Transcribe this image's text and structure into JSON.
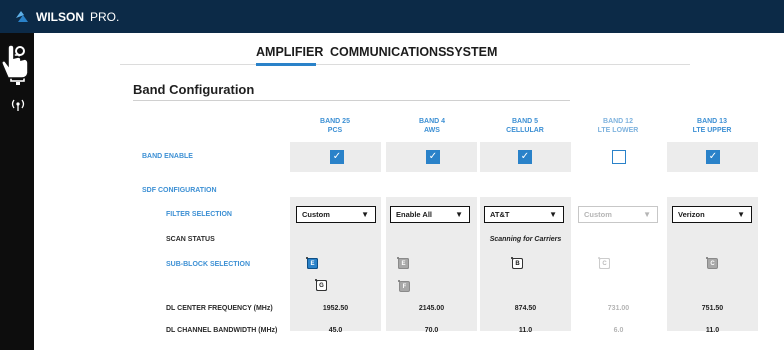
{
  "header": {
    "brand": "WILSON",
    "brand_suffix": "PRO."
  },
  "sidebar": {
    "icons": [
      "settings-icon",
      "network-icon",
      "antenna-icon"
    ]
  },
  "nav": {
    "tabs": [
      "AMPLIFIER",
      "COMMUNICATIONS",
      "SYSTEM"
    ],
    "active": "AMPLIFIER"
  },
  "section": {
    "title": "Band Configuration"
  },
  "columns": [
    {
      "line1": "BAND 25",
      "line2": "PCS",
      "enabled": true
    },
    {
      "line1": "BAND 4",
      "line2": "AWS",
      "enabled": true
    },
    {
      "line1": "BAND 5",
      "line2": "CELLULAR",
      "enabled": true
    },
    {
      "line1": "BAND 12",
      "line2": "LTE LOWER",
      "enabled": false
    },
    {
      "line1": "BAND 13",
      "line2": "LTE UPPER",
      "enabled": true
    }
  ],
  "rows": {
    "band_enable": "BAND ENABLE",
    "sdf_configuration": "SDF CONFIGURATION",
    "filter_selection": "FILTER SELECTION",
    "scan_status": "SCAN STATUS",
    "sub_block_selection": "SUB-BLOCK SELECTION",
    "dl_center_frequency": "DL CENTER FREQUENCY (MHz)",
    "dl_channel_bandwidth": "DL CHANNEL BANDWIDTH (MHz)"
  },
  "filters": [
    "Custom",
    "Enable All",
    "AT&T",
    "Custom",
    "Verizon"
  ],
  "scan_status": [
    "",
    "",
    "Scanning for Carriers",
    "",
    ""
  ],
  "sub_blocks": {
    "band25_row1": [
      "A",
      "D",
      "B",
      "E"
    ],
    "band25_row2": [
      "F",
      "C",
      "G"
    ],
    "band4": [
      "A",
      "D",
      "B",
      "E"
    ],
    "band4_row2": [
      "F"
    ],
    "band5": [
      "A",
      "B"
    ],
    "band12": [
      "A",
      "B",
      "C"
    ],
    "band13": [
      "C"
    ]
  },
  "dl_center_frequency": [
    "1952.50",
    "2145.00",
    "874.50",
    "731.00",
    "751.50"
  ],
  "dl_channel_bandwidth": [
    "45.0",
    "70.0",
    "11.0",
    "6.0",
    "11.0"
  ],
  "colors": {
    "topbar": "#0c2a47",
    "accent": "#2a82c9",
    "label_blue": "#3d90d4"
  }
}
